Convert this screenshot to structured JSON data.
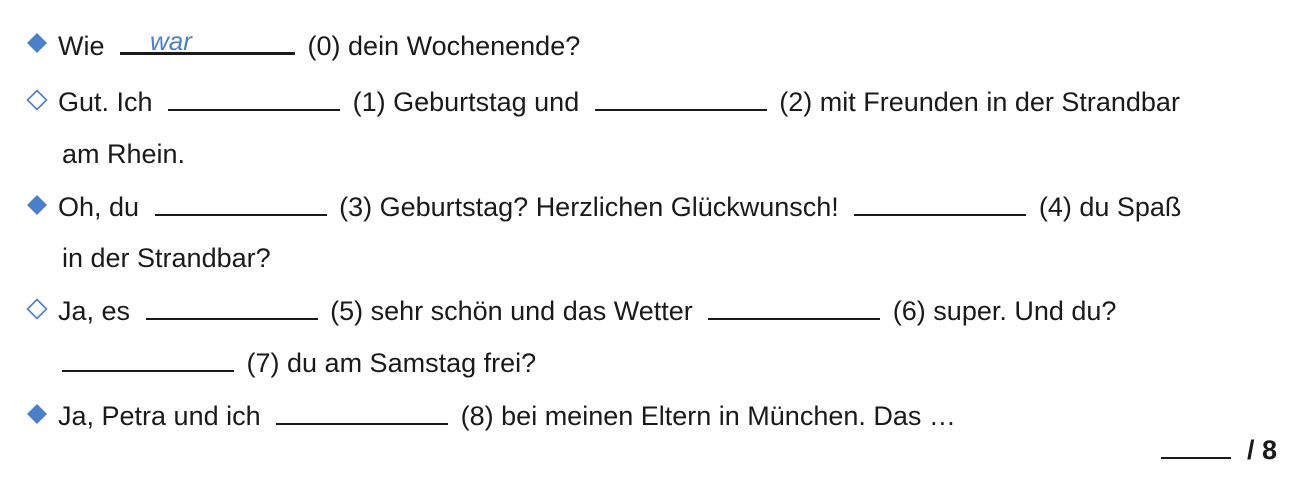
{
  "dialogue": {
    "l1": {
      "a": "Wie",
      "answer": "war",
      "b": "(0) dein Wochenende?"
    },
    "l2": {
      "a": "Gut. Ich",
      "b": "(1) Geburtstag und",
      "c": "(2) mit Freunden in der Strandbar"
    },
    "l3": {
      "a": "am Rhein."
    },
    "l4": {
      "a": "Oh, du",
      "b": "(3) Geburtstag? Herzlichen Glückwunsch!",
      "c": "(4) du Spaß"
    },
    "l5": {
      "a": "in der Strandbar?"
    },
    "l6": {
      "a": "Ja, es",
      "b": "(5) sehr schön und das Wetter",
      "c": "(6) super. Und du?"
    },
    "l7": {
      "a": "(7) du am Samstag frei?"
    },
    "l8": {
      "a": "Ja, Petra und ich",
      "b": "(8) bei meinen Eltern in München. Das …"
    }
  },
  "score": {
    "total": "/ 8"
  },
  "colors": {
    "bullet": "#4a7fc9",
    "answer": "#4a7fc9"
  },
  "icons": {
    "filled": "diamond-filled-icon",
    "outline": "diamond-outline-icon"
  }
}
